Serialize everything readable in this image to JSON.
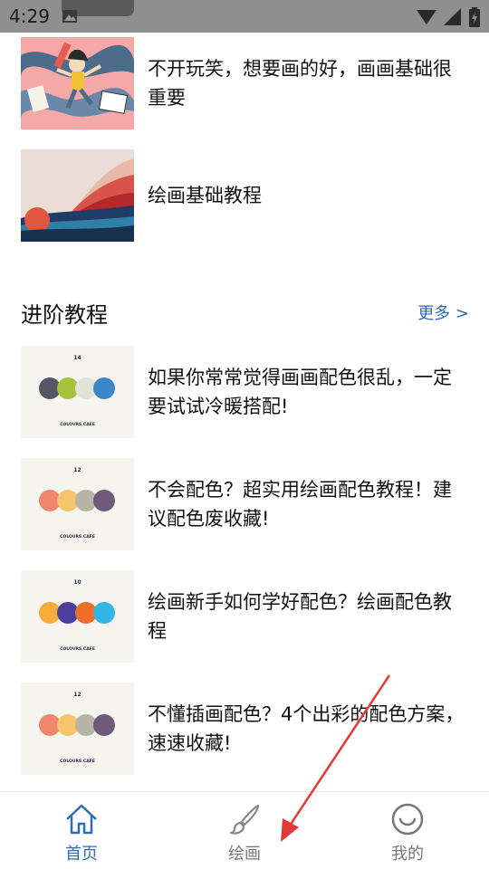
{
  "status_bar": {
    "time": "4:29"
  },
  "basics": {
    "items": [
      {
        "title": "不开玩笑，想要画的好，画画基础很重要"
      },
      {
        "title": "绘画基础教程"
      }
    ]
  },
  "advanced": {
    "section_title": "进阶教程",
    "more_label": "更多 >",
    "items": [
      {
        "title": "如果你常常觉得画画配色很乱，一定要试试冷暖搭配!",
        "palette_number": "14",
        "brand": "COLOURS.CAFE",
        "swatches": [
          "#555566",
          "#a8c13c",
          "#e2e2d8",
          "#3a86c8"
        ]
      },
      {
        "title": "不会配色？超实用绘画配色教程！建议配色废收藏!",
        "palette_number": "12",
        "brand": "COLOURS.CAFE",
        "swatches": [
          "#f2866b",
          "#f6c46b",
          "#b8b3a7",
          "#6f5a7c"
        ]
      },
      {
        "title": "绘画新手如何学好配色？绘画配色教程",
        "palette_number": "10",
        "brand": "COLOURS.CAFE",
        "swatches": [
          "#f5ac3a",
          "#4a3f9a",
          "#ef6e2a",
          "#33b5e5"
        ]
      },
      {
        "title": "不懂插画配色？4个出彩的配色方案，速速收藏!",
        "palette_number": "12",
        "brand": "COLOURS.CAFE",
        "swatches": [
          "#f2866b",
          "#f6c46b",
          "#b8b3a7",
          "#6f5a7c"
        ]
      }
    ]
  },
  "bottom_nav": {
    "home_label": "首页",
    "draw_label": "绘画",
    "mine_label": "我的",
    "active_color": "#2f6bb2",
    "inactive_color": "#777777"
  },
  "annotation": {
    "arrow_color": "#e03a3a"
  }
}
